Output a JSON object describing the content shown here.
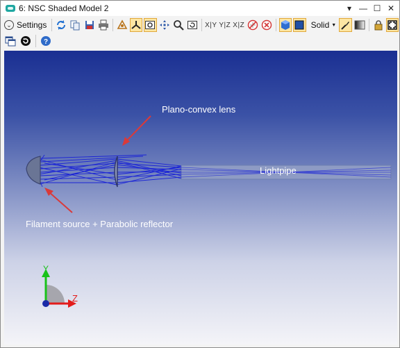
{
  "window": {
    "title": "6: NSC Shaded Model 2",
    "controls": [
      "▾",
      "—",
      "☐",
      "✕"
    ]
  },
  "toolbar": {
    "settings_label": "Settings",
    "solid_label": "Solid",
    "axis_labels": [
      "X|Y",
      "Y|Z",
      "X|Z"
    ]
  },
  "viewport": {
    "annotations": {
      "lens": "Plano-convex lens",
      "lightpipe": "Lightpipe",
      "source": "Filament source + Parabolic reflector"
    },
    "axis": {
      "y": "Y",
      "z": "Z"
    },
    "colors": {
      "rays": "#1a23d6",
      "arrows": "#d93a3a",
      "y_axis": "#19c21a",
      "z_axis": "#e31b1b"
    }
  }
}
